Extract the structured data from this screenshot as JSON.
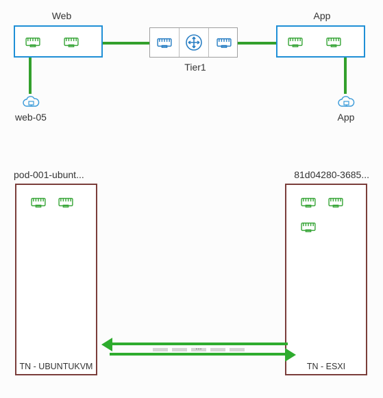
{
  "top": {
    "left_switch": {
      "label": "Web"
    },
    "right_switch": {
      "label": "App"
    },
    "router": {
      "label": "Tier1"
    },
    "left_vm": {
      "label": "web-05"
    },
    "right_vm": {
      "label": "App"
    }
  },
  "hosts": {
    "left": {
      "title": "pod-001-ubunt...",
      "type_label": "TN - UBUNTUKVM"
    },
    "right": {
      "title": "81d04280-3685...",
      "type_label": "TN - ESXI"
    }
  },
  "tunnel": {
    "ellipsis": "..."
  }
}
